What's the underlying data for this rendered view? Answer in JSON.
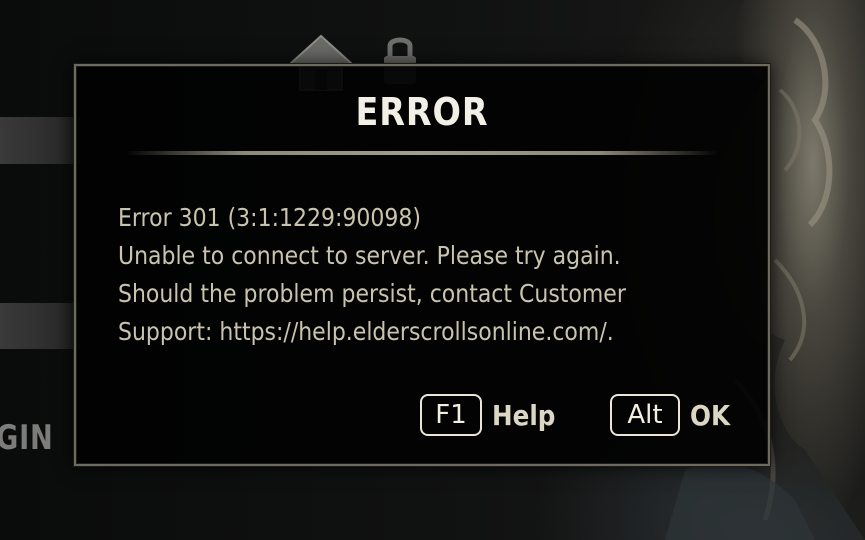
{
  "background": {
    "login_stub_label": "GIN",
    "icons": [
      "home-icon",
      "lock-icon"
    ]
  },
  "dialog": {
    "title": "ERROR",
    "message_lines": [
      "Error 301 (3:1:1229:90098)",
      "Unable to connect to server. Please try again.",
      "Should the problem persist, contact Customer",
      "Support: https://help.elderscrollsonline.com/."
    ],
    "actions": {
      "help": {
        "key": "F1",
        "label": "Help"
      },
      "ok": {
        "key": "Alt",
        "label": "OK"
      }
    }
  },
  "colors": {
    "dialog_background": "#050505",
    "dialog_border": "#6d6a5e",
    "title_text": "#f1efe6",
    "message_text": "#c9c4ad"
  }
}
